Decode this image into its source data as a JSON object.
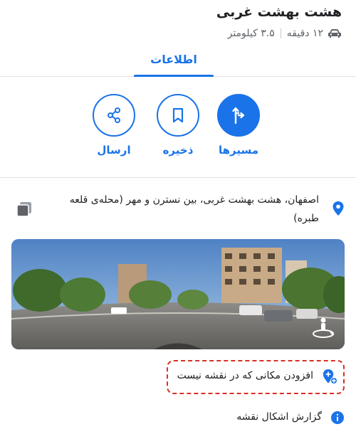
{
  "place": {
    "title": "هشت بهشت غربی",
    "duration": "۱۲ دقیقه",
    "distance": "۳.۵ کیلومتر"
  },
  "tabs": [
    {
      "label": "اطلاعات",
      "selected": true
    }
  ],
  "actions": {
    "routes_label": "مسیرها",
    "save_label": "ذخیره",
    "share_label": "ارسال"
  },
  "address": {
    "text": "اصفهان، هشت بهشت غربی، بین نسترن و مهر (محله‌ی قلعه طبره)"
  },
  "links": {
    "add_place_label": "افزودن مکانی که در نقشه نیست",
    "report_label": "گزارش اشکال نقشه"
  },
  "icons": {
    "car": "car-icon",
    "routes": "directions-icon",
    "save": "bookmark-icon",
    "share": "share-icon",
    "pin": "location-pin-icon",
    "copy": "copy-icon",
    "streetview_360": "street-view-360-icon",
    "add_place": "add-location-icon",
    "report": "info-icon"
  },
  "colors": {
    "accent": "#1a73e8",
    "highlight": "#d93025",
    "text_secondary": "#5f6368"
  }
}
